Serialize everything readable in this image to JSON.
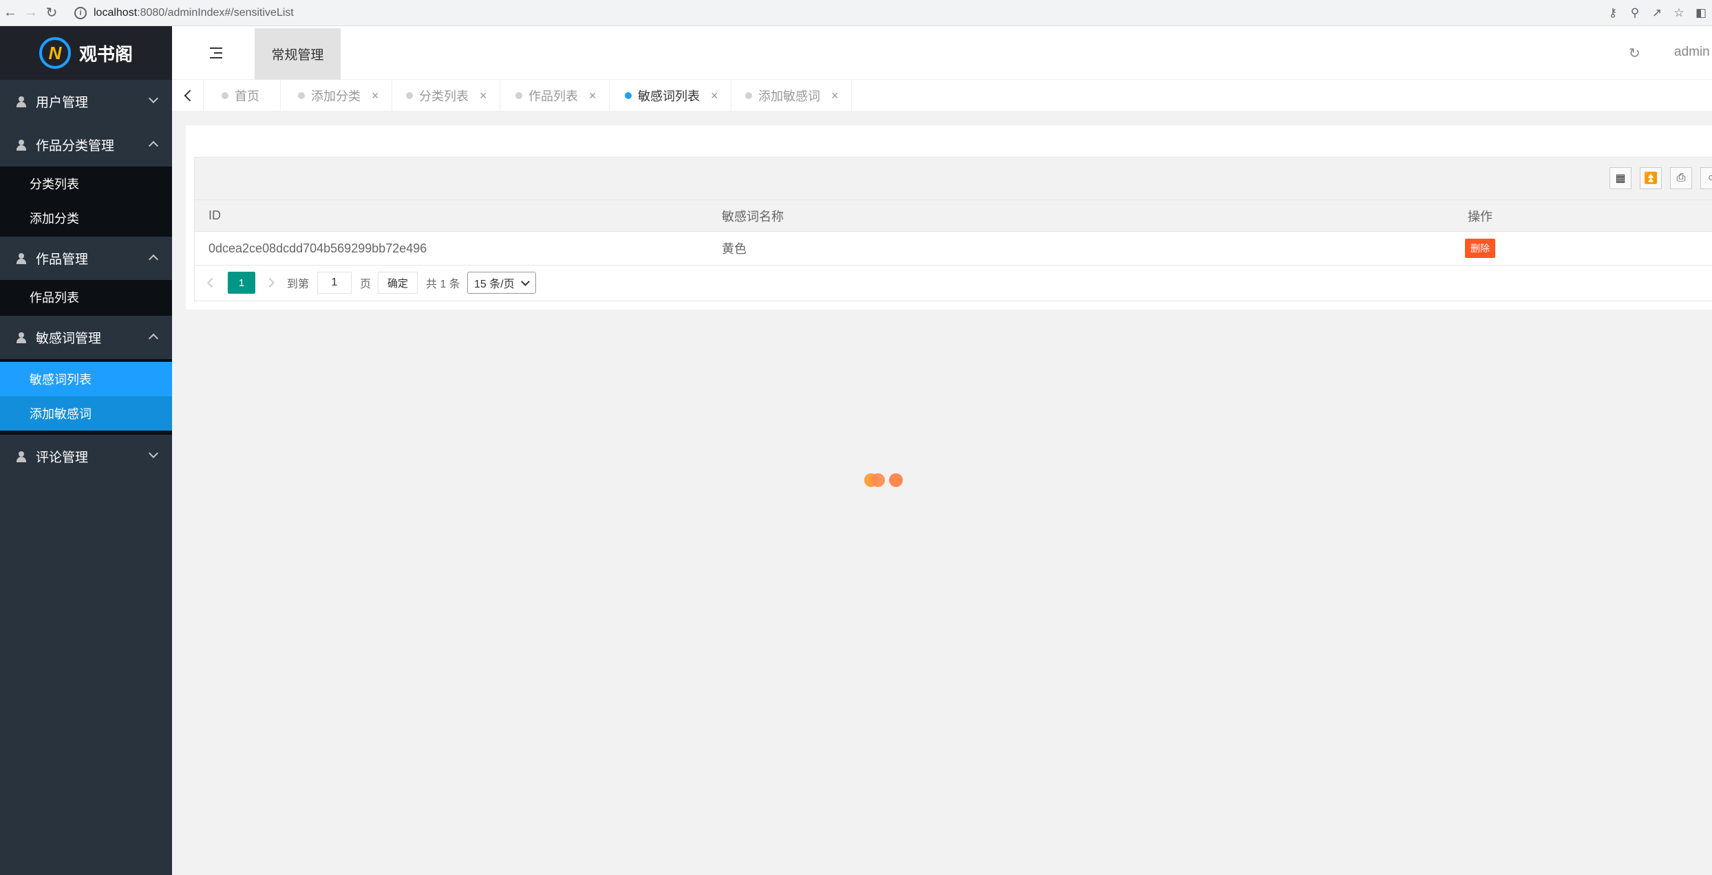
{
  "browser": {
    "url_host": "localhost",
    "url_path": ":8080/adminIndex#/sensitiveList"
  },
  "sidebar": {
    "logo_text": "观书阁",
    "groups": [
      {
        "label": "用户管理",
        "expanded": false,
        "items": []
      },
      {
        "label": "作品分类管理",
        "expanded": true,
        "items": [
          "分类列表",
          "添加分类"
        ]
      },
      {
        "label": "作品管理",
        "expanded": true,
        "items": [
          "作品列表"
        ]
      },
      {
        "label": "敏感词管理",
        "expanded": true,
        "items": [
          "敏感词列表",
          "添加敏感词"
        ]
      },
      {
        "label": "评论管理",
        "expanded": false,
        "items": []
      }
    ],
    "active_item": "敏感词列表"
  },
  "header": {
    "nav_item": "常规管理",
    "user": "admin"
  },
  "tabs": [
    {
      "label": "首页",
      "closable": false,
      "active": false
    },
    {
      "label": "添加分类",
      "closable": true,
      "active": false
    },
    {
      "label": "分类列表",
      "closable": true,
      "active": false
    },
    {
      "label": "作品列表",
      "closable": true,
      "active": false
    },
    {
      "label": "敏感词列表",
      "closable": true,
      "active": true
    },
    {
      "label": "添加敏感词",
      "closable": true,
      "active": false
    }
  ],
  "table": {
    "columns": [
      "ID",
      "敏感词名称",
      "操作"
    ],
    "rows": [
      {
        "id": "0dcea2ce08dcdd704b569299bb72e496",
        "name": "黄色",
        "action": "删除"
      }
    ]
  },
  "pager": {
    "current_page": "1",
    "goto_label": "到第",
    "goto_value": "1",
    "page_unit": "页",
    "confirm": "确定",
    "total": "共 1 条",
    "page_size": "15 条/页"
  },
  "colors": {
    "sidebar_bg": "#28333e",
    "active_blue": "#1e9fff",
    "pager_green": "#009688",
    "delete_orange": "#ff5722"
  }
}
